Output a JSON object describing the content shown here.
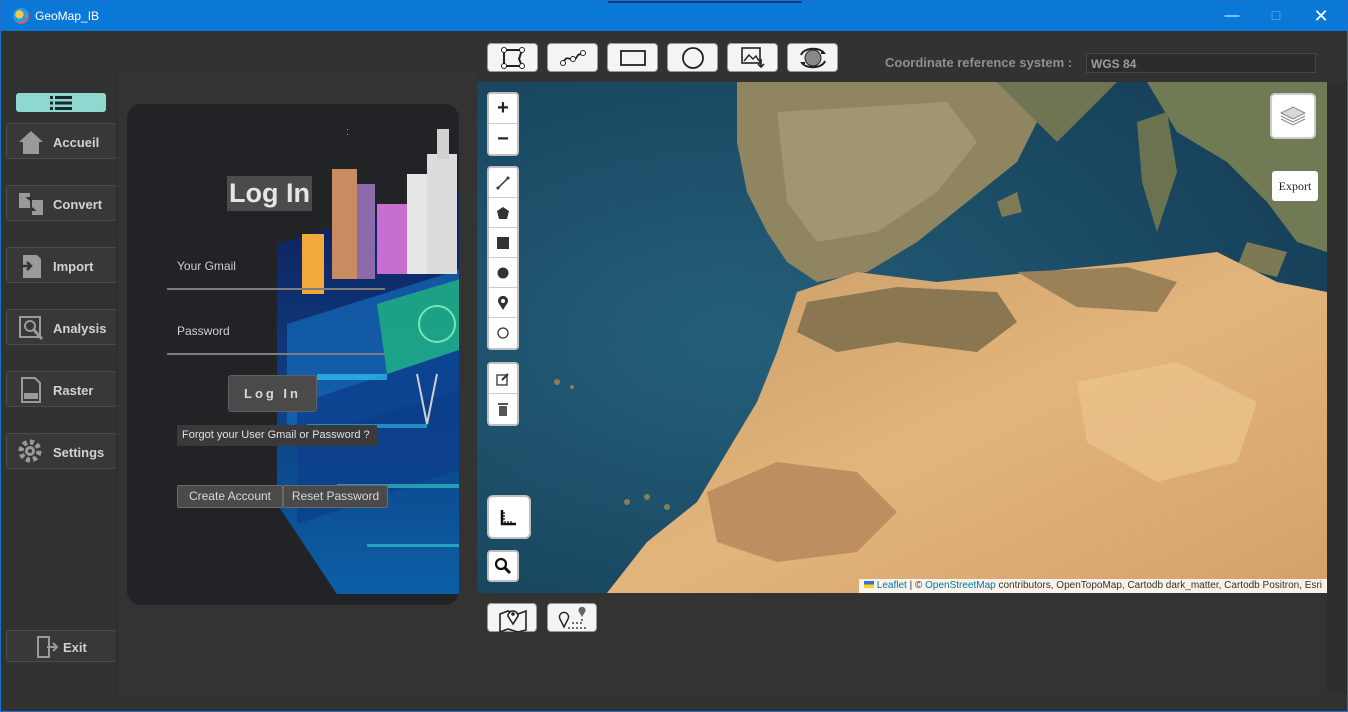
{
  "window": {
    "title": "GeoMap_IB",
    "minimize": "—",
    "maximize": "☐",
    "close": "✕"
  },
  "nav": {
    "items": [
      {
        "label": "Accueil",
        "icon": "home-icon"
      },
      {
        "label": "Convert",
        "icon": "convert-icon"
      },
      {
        "label": "Import",
        "icon": "import-icon"
      },
      {
        "label": "Analysis",
        "icon": "analysis-icon"
      },
      {
        "label": "Raster",
        "icon": "tiff-icon"
      },
      {
        "label": "Settings",
        "icon": "gear-icon"
      }
    ],
    "exit": "Exit"
  },
  "login": {
    "title": "Log In",
    "colon": ":",
    "email_label": "Your  Gmail",
    "password_label": "Password",
    "login_button": "Log In",
    "forgot": "Forgot your User Gmail or Password ?",
    "create_account": "Create Account",
    "reset_password": "Reset Password"
  },
  "toolbar": {
    "tools": [
      "polygon-edit-icon",
      "polyline-icon",
      "rectangle-icon",
      "circle-icon",
      "image-export-icon",
      "globe-sync-icon"
    ],
    "crs_label": "Coordinate reference system :",
    "crs_value": "WGS 84"
  },
  "map": {
    "zoom_in": "+",
    "zoom_out": "−",
    "draw_tools": [
      "polyline-icon",
      "polygon-icon",
      "rectangle-icon",
      "circle-icon",
      "marker-icon",
      "circlemarker-icon"
    ],
    "edit_tools": [
      "edit-icon",
      "trash-icon"
    ],
    "export": "Export",
    "attribution": {
      "leaflet": "Leaflet",
      "sep": " | © ",
      "osm": "OpenStreetMap",
      "rest": " contributors, OpenTopoMap, Cartodb dark_matter, Cartodb Positron, Esri"
    }
  },
  "bottom": {
    "tools": [
      "map-pin-icon",
      "route-icon"
    ]
  }
}
